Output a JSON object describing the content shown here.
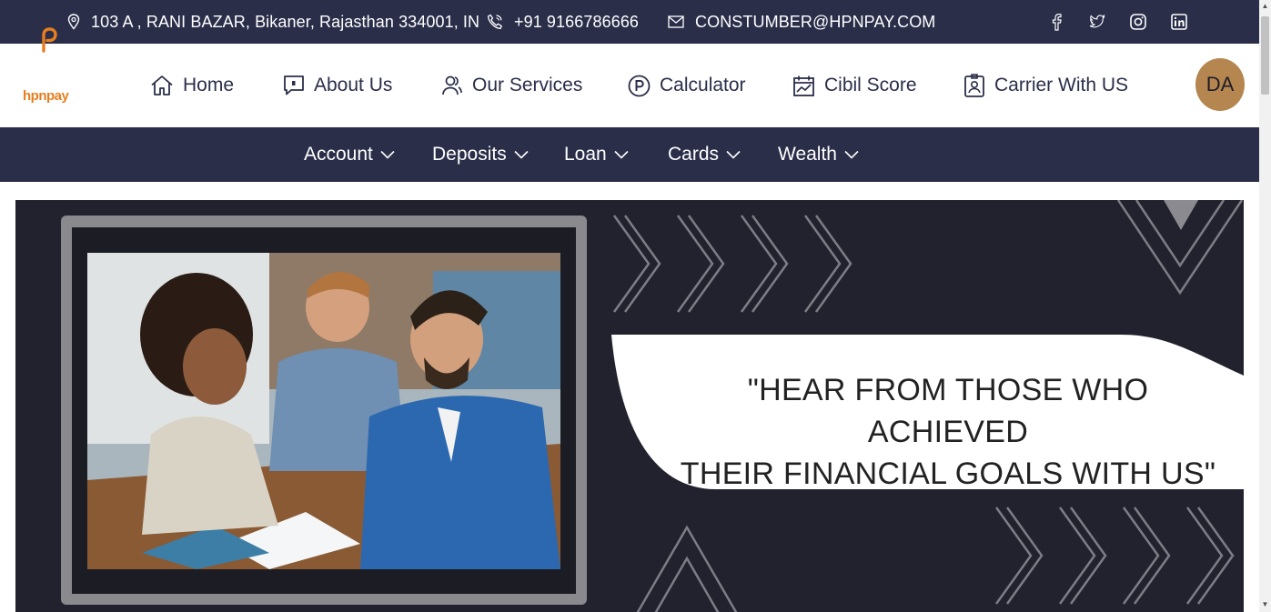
{
  "topbar": {
    "address": "103 A , RANI BAZAR, Bikaner, Rajasthan 334001, IN",
    "phone": "+91 9166786666",
    "email": "CONSTUMBER@HPNPAY.COM",
    "social": [
      "facebook-icon",
      "twitter-icon",
      "instagram-icon",
      "linkedin-icon"
    ]
  },
  "brand": {
    "logo_text": "hpnpay",
    "accent": "#e67e1f"
  },
  "nav": {
    "items": [
      {
        "label": "Home",
        "icon": "home-icon"
      },
      {
        "label": "About Us",
        "icon": "chat-square-icon"
      },
      {
        "label": "Our Services",
        "icon": "users-icon"
      },
      {
        "label": "Calculator",
        "icon": "parking-circle-icon"
      },
      {
        "label": "Cibil Score",
        "icon": "chart-calendar-icon"
      },
      {
        "label": "Carrier With US",
        "icon": "id-badge-icon"
      }
    ],
    "avatar_initials": "DA"
  },
  "subnav": {
    "items": [
      {
        "label": "Account"
      },
      {
        "label": "Deposits"
      },
      {
        "label": "Loan"
      },
      {
        "label": "Cards"
      },
      {
        "label": "Wealth"
      }
    ]
  },
  "hero": {
    "quote_line1": "\"HEAR FROM THOSE WHO ACHIEVED",
    "quote_line2": "THEIR FINANCIAL GOALS WITH US\""
  },
  "colors": {
    "navy": "#2a2e49",
    "hero_bg": "#22222e",
    "avatar": "#b58650"
  }
}
